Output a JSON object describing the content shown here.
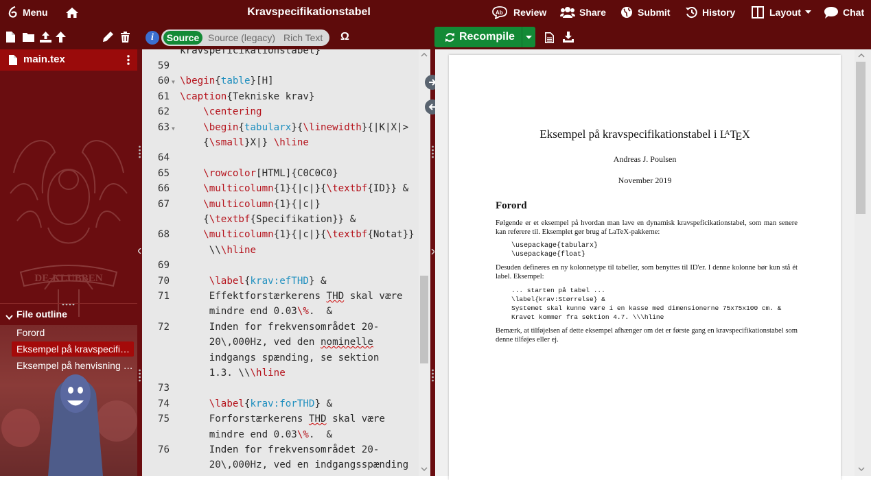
{
  "topbar": {
    "menu_label": "Menu",
    "title": "Kravspecifikationstabel",
    "review_label": "Review",
    "share_label": "Share",
    "submit_label": "Submit",
    "history_label": "History",
    "layout_label": "Layout",
    "chat_label": "Chat"
  },
  "editor_toolbar": {
    "info": "i",
    "tabs": [
      "Source",
      "Source (legacy)",
      "Rich Text"
    ],
    "omega": "Ω"
  },
  "pdf_toolbar": {
    "recompile_label": "Recompile"
  },
  "sidebar": {
    "file_name": "main.tex",
    "outline_title": "File outline",
    "outline_items": [
      "Forord",
      "Eksempel på kravspecifikationstabel",
      "Eksempel på henvisning til tabel"
    ],
    "logo_text": "DE-KLUBBEN"
  },
  "editor": {
    "top_partial": "kravspeficikationstabel}",
    "lines": [
      {
        "n": "59",
        "fold": false,
        "text": ""
      },
      {
        "n": "60",
        "fold": true,
        "text": "\\begin{table}[H]"
      },
      {
        "n": "61",
        "fold": false,
        "text": "\\caption{Tekniske krav}"
      },
      {
        "n": "62",
        "fold": false,
        "text": "    \\centering"
      },
      {
        "n": "63",
        "fold": true,
        "text": "    \\begin{tabularx}{\\linewidth}{|K|X|>"
      },
      {
        "n": "",
        "fold": false,
        "text": "    {\\small}X|} \\hline"
      },
      {
        "n": "64",
        "fold": false,
        "text": ""
      },
      {
        "n": "65",
        "fold": false,
        "text": "    \\rowcolor[HTML]{C0C0C0}"
      },
      {
        "n": "66",
        "fold": false,
        "text": "    \\multicolumn{1}{|c|}{\\textbf{ID}} &"
      },
      {
        "n": "67",
        "fold": false,
        "text": "    \\multicolumn{1}{|c|}"
      },
      {
        "n": "",
        "fold": false,
        "text": "    {\\textbf{Specifikation}} &"
      },
      {
        "n": "68",
        "fold": false,
        "text": "    \\multicolumn{1}{|c|}{\\textbf{Notat}}"
      },
      {
        "n": "",
        "fold": false,
        "text": "     \\\\\\hline"
      },
      {
        "n": "69",
        "fold": false,
        "text": ""
      },
      {
        "n": "70",
        "fold": false,
        "text": "     \\label{krav:efTHD} &"
      },
      {
        "n": "71",
        "fold": false,
        "text": "     Effektforstærkerens THD skal være"
      },
      {
        "n": "",
        "fold": false,
        "text": "     mindre end 0.03\\%.  &"
      },
      {
        "n": "72",
        "fold": false,
        "text": "     Inden for frekvensområdet 20-"
      },
      {
        "n": "",
        "fold": false,
        "text": "     20\\,000Hz, ved den nominelle"
      },
      {
        "n": "",
        "fold": false,
        "text": "     indgangs spænding, se sektion"
      },
      {
        "n": "",
        "fold": false,
        "text": "     1.3. \\\\\\hline"
      },
      {
        "n": "73",
        "fold": false,
        "text": ""
      },
      {
        "n": "74",
        "fold": false,
        "text": "     \\label{krav:forTHD} &"
      },
      {
        "n": "75",
        "fold": false,
        "text": "     Forforstærkerens THD skal være"
      },
      {
        "n": "",
        "fold": false,
        "text": "     mindre end 0.03\\%.  &"
      },
      {
        "n": "76",
        "fold": false,
        "text": "     Inden for frekvensområdet 20-"
      },
      {
        "n": "",
        "fold": false,
        "text": "     20\\,000Hz, ved en indgangsspænding"
      }
    ]
  },
  "pdf": {
    "title_prefix": "Eksempel på kravspecifikationstabel i ",
    "latex_logo": "LaTeX",
    "author": "Andreas J. Poulsen",
    "date": "November 2019",
    "section": "Forord",
    "para1": "Følgende er et eksempel på hvordan man lave en dynamisk kravspeficikationstabel, som man senere kan referere til. Eksemplet gør brug af LaTeX-pakkerne:",
    "code1": [
      "\\usepackage{tabularx}",
      "\\usepackage{float}"
    ],
    "para2": "Desuden defineres en ny kolonnetype til tabeller, som benyttes til ID'er. I denne kolonne bør kun stå ét label. Eksempel:",
    "code2": [
      "... starten på tabel ...",
      "\\label{krav:Størrelse} &",
      "Systemet skal kunne være i en kasse med dimensionerne 75x75x100 cm. &",
      "Kravet kommer fra sektion 4.7. \\\\\\hline"
    ],
    "para3": "Bemærk, at tilføjelsen af dette eksempel afhænger om det er første gang en kravspecifikationstabel som denne tilføjes eller ej."
  },
  "colors": {
    "brand": "#5e0b0b",
    "recompile": "#138a36",
    "active": "#9a0b0b"
  }
}
